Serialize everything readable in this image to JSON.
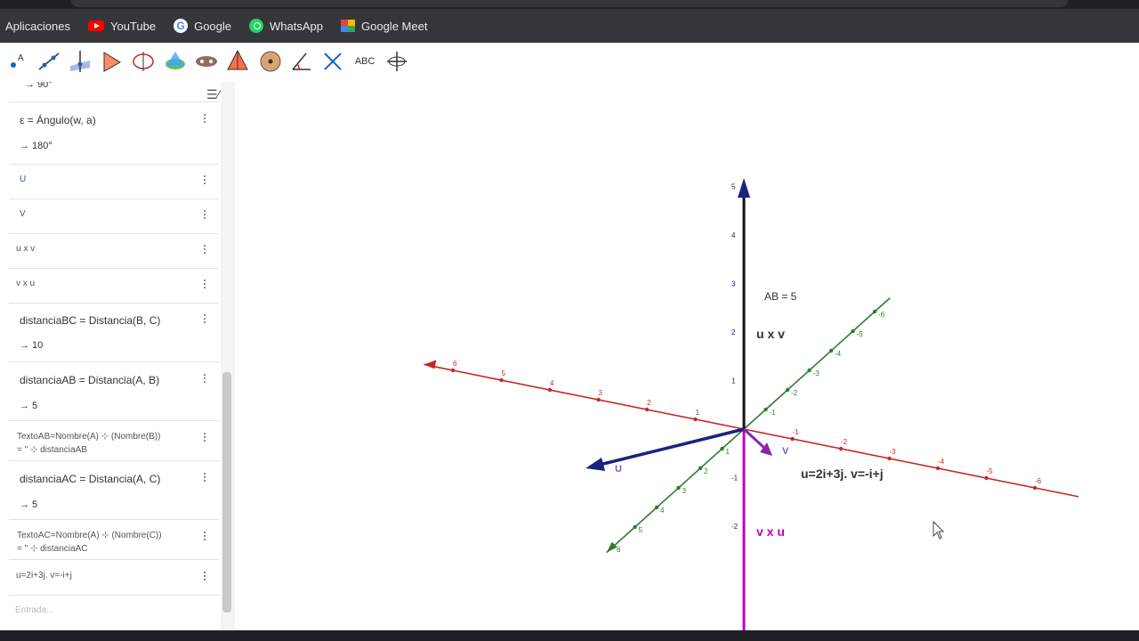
{
  "bookmarks": {
    "apps_label": "Aplicaciones",
    "items": [
      {
        "label": "YouTube",
        "icon": "youtube-icon"
      },
      {
        "label": "Google",
        "icon": "google-icon"
      },
      {
        "label": "WhatsApp",
        "icon": "whatsapp-icon"
      },
      {
        "label": "Google Meet",
        "icon": "google-meet-icon"
      }
    ]
  },
  "toolbar": {
    "text_tool_label": "ABC"
  },
  "algebra": {
    "top_partial": "→ 90°",
    "rows": [
      {
        "main": "ε  =  Ángulo(w, a)",
        "value": "→ 180°"
      },
      {
        "main": "U"
      },
      {
        "main": "V"
      },
      {
        "main": "u x v"
      },
      {
        "main": "v x u"
      },
      {
        "main": "distanciaBC  =  Distancia(B, C)",
        "value": "→ 10"
      },
      {
        "main": "distanciaAB  =  Distancia(A, B)",
        "value": "→ 5"
      },
      {
        "main": "TextoAB=Nombre(A) ⊹ (Nombre(B))",
        "value": "= \" ⊹ distanciaAB"
      },
      {
        "main": "distanciaAC  =  Distancia(A, C)",
        "value": "→ 5"
      },
      {
        "main": "TextoAC=Nombre(A) ⊹ (Nombre(C))",
        "value": "= \" ⊹ distanciaAC"
      },
      {
        "main": "u=2i+3j.   v=-i+j"
      }
    ],
    "input_placeholder": "Entrada..."
  },
  "graphics": {
    "labels": {
      "ab": "AB = 5",
      "uxv": "u x v",
      "vxu": "v x u",
      "u": "U",
      "v": "V",
      "eq": "u=2i+3j.    v=-i+j"
    },
    "colors": {
      "x_axis": "#c62828",
      "y_axis": "#2e7d32",
      "z_axis": "#111111",
      "z_tip": "#1a237e",
      "u_vector": "#1a237e",
      "v_vector": "#8e24aa",
      "vxu": "#c000c0"
    },
    "x_ticks": [
      "6",
      "5",
      "4",
      "3",
      "2",
      "1",
      "-1",
      "-2",
      "-3",
      "-4",
      "-5",
      "-6"
    ],
    "y_ticks": [
      "6",
      "5",
      "4",
      "3",
      "2",
      "1",
      "-1",
      "-2",
      "-3",
      "-4",
      "-5",
      "-6"
    ],
    "z_ticks": [
      "5",
      "4",
      "3",
      "2",
      "1",
      "-1",
      "-2"
    ]
  }
}
